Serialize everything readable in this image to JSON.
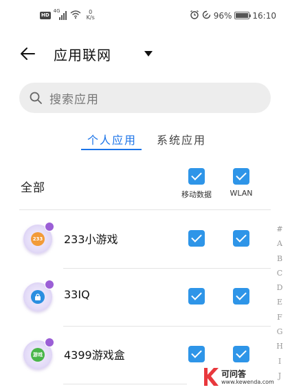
{
  "status_bar": {
    "hd": "HD",
    "network_type": "4G",
    "net_speed_value": "0",
    "net_speed_unit": "K/s",
    "battery_percent": "96%",
    "battery_level": 0.96,
    "time": "16:10"
  },
  "header": {
    "title": "应用联网"
  },
  "search": {
    "placeholder": "搜索应用"
  },
  "tabs": [
    {
      "label": "个人应用",
      "selected": true
    },
    {
      "label": "系统应用",
      "selected": false
    }
  ],
  "columns": {
    "all_label": "全部",
    "mobile_data": "移动数据",
    "wlan": "WLAN"
  },
  "apps": [
    {
      "name": "233小游戏",
      "icon_text": "233",
      "icon_color": "#f29b38",
      "mobile_data": true,
      "wlan": true
    },
    {
      "name": "33IQ",
      "icon_text": "",
      "icon_color": "#2a8ee0",
      "mobile_data": true,
      "wlan": true
    },
    {
      "name": "4399游戏盒",
      "icon_text": "游戏",
      "icon_color": "#49b649",
      "mobile_data": true,
      "wlan": true
    }
  ],
  "alphabet_index": [
    "#",
    "A",
    "B",
    "C",
    "D",
    "E",
    "F",
    "G",
    "H",
    "I",
    "J"
  ],
  "watermark": {
    "cn": "可问答",
    "en": "www.kewenda.com"
  },
  "colors": {
    "accent": "#1a73e8",
    "checkbox": "#2e95e8"
  }
}
